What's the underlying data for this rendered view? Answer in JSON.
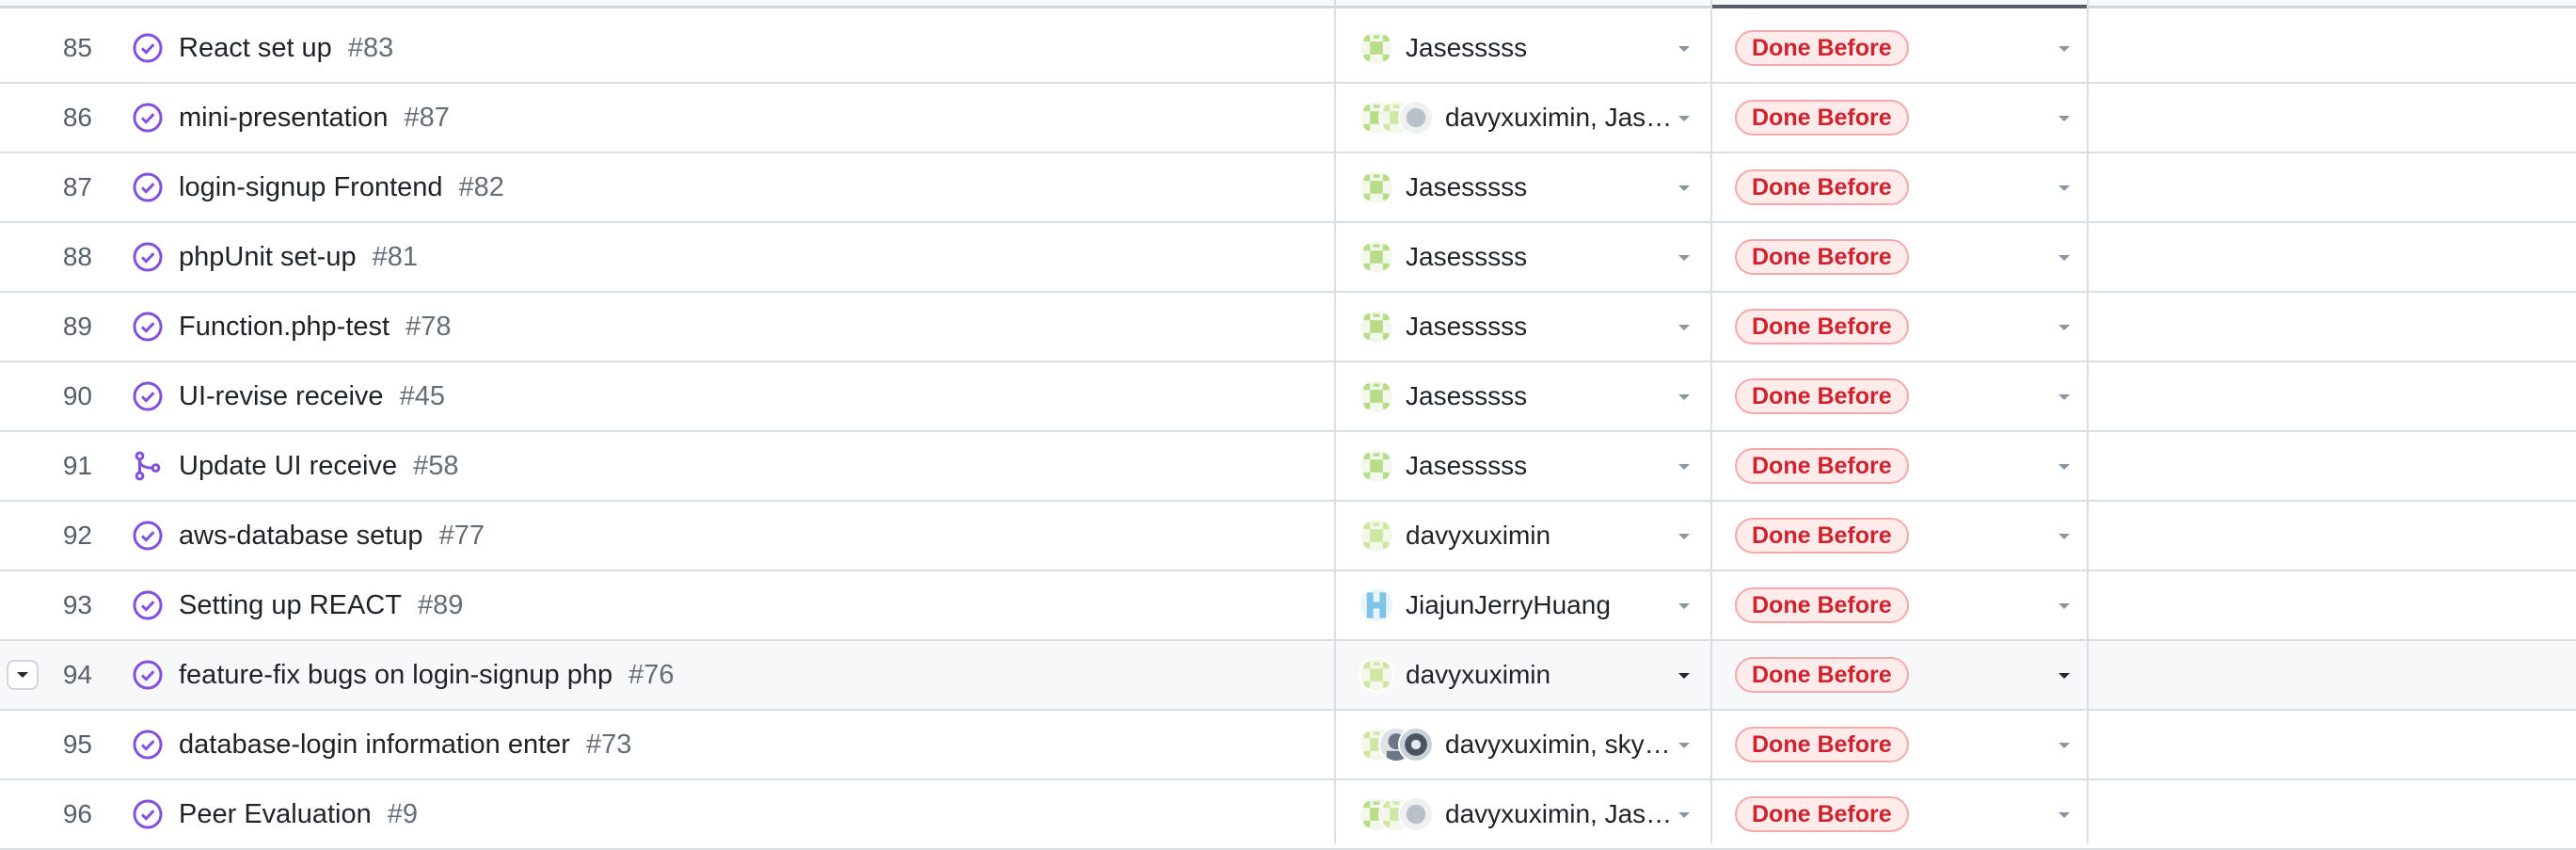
{
  "colors": {
    "done_icon": "#8250df",
    "badge_text": "#cf222e",
    "badge_bg": "#ffebe9",
    "badge_border": "#f5a9ab"
  },
  "rows": [
    {
      "num": "85",
      "icon": "done-circle-icon",
      "title": "React set up",
      "issue": "#83",
      "assignee": "Jasesssss",
      "avatars": [
        "green"
      ],
      "status": "Done Before"
    },
    {
      "num": "86",
      "icon": "done-circle-icon",
      "title": "mini-presentation",
      "issue": "#87",
      "assignee": "davyxuximin, Jas…",
      "avatars": [
        "green",
        "lightgreen",
        "gray"
      ],
      "status": "Done Before"
    },
    {
      "num": "87",
      "icon": "done-circle-icon",
      "title": "login-signup Frontend",
      "issue": "#82",
      "assignee": "Jasesssss",
      "avatars": [
        "green"
      ],
      "status": "Done Before"
    },
    {
      "num": "88",
      "icon": "done-circle-icon",
      "title": "phpUnit set-up",
      "issue": "#81",
      "assignee": "Jasesssss",
      "avatars": [
        "green"
      ],
      "status": "Done Before"
    },
    {
      "num": "89",
      "icon": "done-circle-icon",
      "title": "Function.php-test",
      "issue": "#78",
      "assignee": "Jasesssss",
      "avatars": [
        "green"
      ],
      "status": "Done Before"
    },
    {
      "num": "90",
      "icon": "done-circle-icon",
      "title": "UI-revise receive",
      "issue": "#45",
      "assignee": "Jasesssss",
      "avatars": [
        "green"
      ],
      "status": "Done Before"
    },
    {
      "num": "91",
      "icon": "merged-pr-icon",
      "title": "Update UI receive",
      "issue": "#58",
      "assignee": "Jasesssss",
      "avatars": [
        "green"
      ],
      "status": "Done Before"
    },
    {
      "num": "92",
      "icon": "done-circle-icon",
      "title": "aws-database setup",
      "issue": "#77",
      "assignee": "davyxuximin",
      "avatars": [
        "lightgreen"
      ],
      "status": "Done Before"
    },
    {
      "num": "93",
      "icon": "done-circle-icon",
      "title": "Setting up REACT",
      "issue": "#89",
      "assignee": "JiajunJerryHuang",
      "avatars": [
        "blue"
      ],
      "status": "Done Before"
    },
    {
      "num": "94",
      "icon": "done-circle-icon",
      "title": "feature-fix bugs on login-signup php",
      "issue": "#76",
      "assignee": "davyxuximin",
      "avatars": [
        "lightgreen"
      ],
      "status": "Done Before"
    },
    {
      "num": "95",
      "icon": "done-circle-icon",
      "title": "database-login information enter",
      "issue": "#73",
      "assignee": "davyxuximin, sky…",
      "avatars": [
        "lightgreen",
        "dark",
        "photo"
      ],
      "status": "Done Before"
    },
    {
      "num": "96",
      "icon": "done-circle-icon",
      "title": "Peer Evaluation",
      "issue": "#9",
      "assignee": "davyxuximin, Jas…",
      "avatars": [
        "green",
        "lightgreen",
        "gray"
      ],
      "status": "Done Before"
    }
  ]
}
